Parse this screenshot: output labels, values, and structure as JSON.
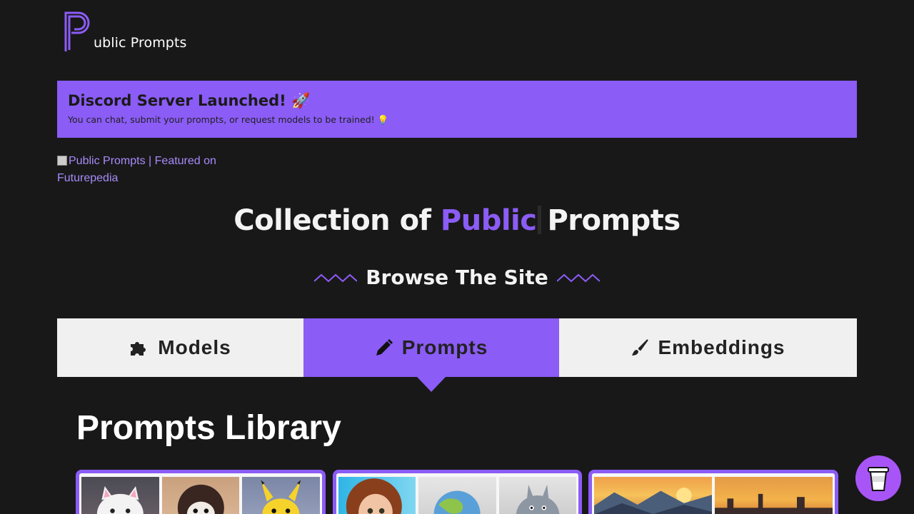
{
  "brand": {
    "logo_text": "ublic Prompts"
  },
  "banner": {
    "title": "Discord Server Launched! 🚀",
    "subtitle": "You can chat, submit your prompts, or request models to be trained! 💡"
  },
  "featured": {
    "alt_text": "Public Prompts | Featured on Futurepedia"
  },
  "hero": {
    "prefix": "Collection of",
    "accent": "Public",
    "suffix": "Prompts"
  },
  "browse": {
    "title": "Browse The Site"
  },
  "tabs": [
    {
      "label": "Models",
      "icon": "puzzle-icon",
      "active": false
    },
    {
      "label": "Prompts",
      "icon": "pencil-icon",
      "active": true
    },
    {
      "label": "Embeddings",
      "icon": "brush-icon",
      "active": false
    }
  ],
  "library": {
    "title": "Prompts Library"
  },
  "colors": {
    "accent": "#8b5cf6",
    "background": "#181818",
    "tab_inactive": "#f0f0f0",
    "coffee_button": "#a855f7"
  },
  "cards": [
    {
      "thumbnails": [
        "white-cat-plush",
        "lion-plush",
        "pikachu-plush"
      ]
    },
    {
      "thumbnails": [
        "cartoon-girl",
        "earth-plush",
        "totoro-plush"
      ]
    },
    {
      "thumbnails": [
        "mountain-sunset",
        "city-sunset"
      ]
    }
  ]
}
